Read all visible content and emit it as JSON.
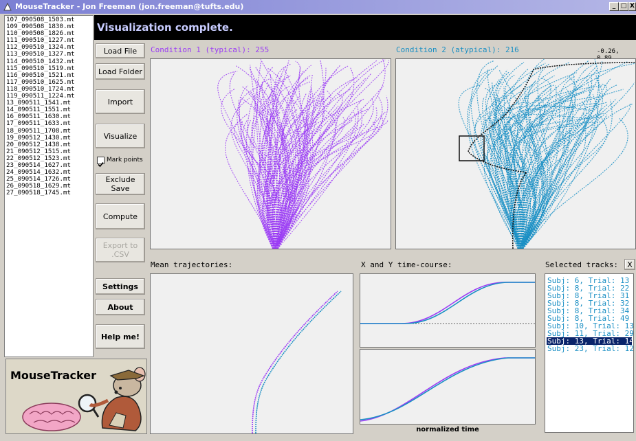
{
  "window": {
    "title": "MouseTracker - Jon Freeman (jon.freeman@tufts.edu)",
    "min_glyph": "_",
    "max_glyph": "□",
    "close_glyph": "X"
  },
  "files": [
    "107_090508_1503.mt",
    "109_090508_1830.mt",
    "110_090508_1826.mt",
    "111_090510_1227.mt",
    "112_090510_1324.mt",
    "113_090510_1327.mt",
    "114_090510_1432.mt",
    "115_090510_1519.mt",
    "116_090510_1521.mt",
    "117_090510_1625.mt",
    "118_090510_1724.mt",
    "119_090511_1224.mt",
    "13_090511_1541.mt",
    "14_090511_1551.mt",
    "16_090511_1630.mt",
    "17_090511_1633.mt",
    "18_090511_1708.mt",
    "19_090512_1430.mt",
    "20_090512_1438.mt",
    "21_090512_1515.mt",
    "22_090512_1523.mt",
    "23_090514_1627.mt",
    "24_090514_1632.mt",
    "25_090514_1726.mt",
    "26_090518_1629.mt",
    "27_090518_1745.mt"
  ],
  "status": "Visualization complete.",
  "buttons": {
    "load_file": "Load File",
    "load_folder": "Load Folder",
    "import": "Import",
    "visualize": "Visualize",
    "mark_points": "Mark points",
    "exclude_save": "Exclude\nSave",
    "compute": "Compute",
    "export_csv": "Export to\n.CSV",
    "settings": "Settings",
    "about": "About",
    "help": "Help me!"
  },
  "checkbox_mark_points_checked": true,
  "condition1": {
    "label": "Condition 1 (typical): 255",
    "color": "#9b3cf5"
  },
  "condition2": {
    "label": "Condition 2 (atypical): 216",
    "color": "#1a8fc4"
  },
  "coords_readout": "-0.26, 0.89",
  "sections": {
    "mean_trajectories": "Mean trajectories:",
    "xy_timecourse": "X and Y time-course:",
    "normalized_time": "normalized time",
    "selected_tracks": "Selected tracks:",
    "clear_glyph": "X"
  },
  "selected_tracks": [
    {
      "text": "Subj: 6, Trial: 13",
      "selected": false
    },
    {
      "text": "Subj: 8, Trial: 22",
      "selected": false
    },
    {
      "text": "Subj: 8, Trial: 31",
      "selected": false
    },
    {
      "text": "Subj: 8, Trial: 32",
      "selected": false
    },
    {
      "text": "Subj: 8, Trial: 34",
      "selected": false
    },
    {
      "text": "Subj: 8, Trial: 49",
      "selected": false
    },
    {
      "text": "Subj: 10, Trial: 13",
      "selected": false
    },
    {
      "text": "Subj: 11, Trial: 29",
      "selected": false
    },
    {
      "text": "Subj: 13, Trial: 14",
      "selected": true
    },
    {
      "text": "Subj: 23, Trial: 12",
      "selected": false
    }
  ],
  "logo": {
    "text": "MouseTracker"
  }
}
